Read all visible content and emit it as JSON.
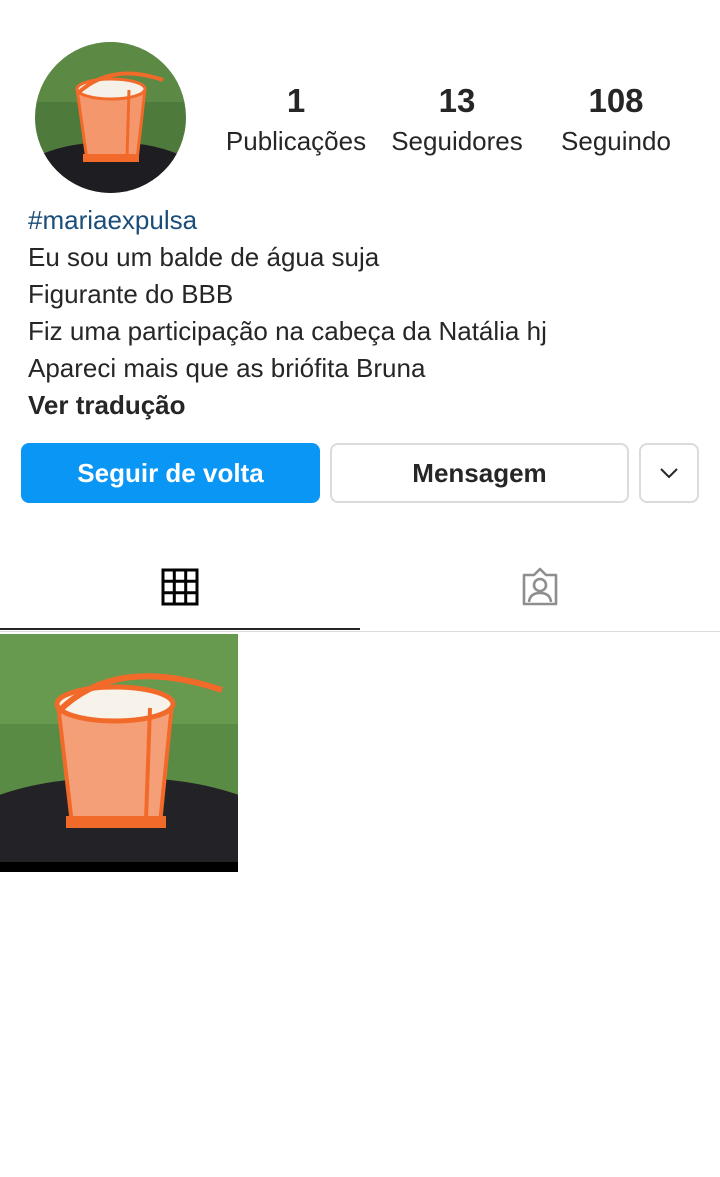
{
  "profile": {
    "stats": [
      {
        "value": "1",
        "label": "Publicações"
      },
      {
        "value": "13",
        "label": "Seguidores"
      },
      {
        "value": "108",
        "label": "Seguindo"
      }
    ],
    "bio": {
      "hashtag": "#mariaexpulsa",
      "lines": [
        "Eu sou um balde de água suja",
        "Figurante do BBB",
        "Fiz uma participação na cabeça da Natália hj",
        "Apareci mais que as briófita Bruna"
      ],
      "translate_label": "Ver tradução"
    }
  },
  "actions": {
    "follow_back_label": "Seguir de volta",
    "message_label": "Mensagem",
    "more_icon": "chevron-down-icon"
  },
  "tabs": [
    {
      "icon": "grid-icon",
      "active": true
    },
    {
      "icon": "tagged-person-icon",
      "active": false
    }
  ],
  "colors": {
    "primary_button": "#0a96f5",
    "hashtag": "#1a4d7a",
    "text": "#262626",
    "border": "#dbdbdb"
  }
}
